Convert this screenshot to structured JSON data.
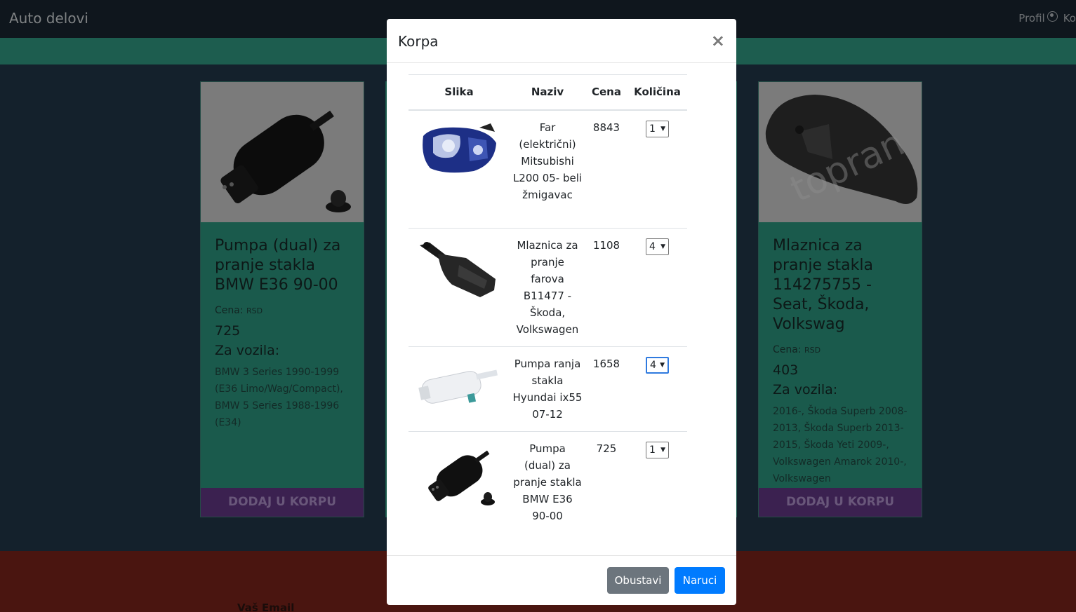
{
  "navbar": {
    "brand": "Auto delovi",
    "profile_label": "Profil",
    "cart_label": "Ko"
  },
  "cards": [
    {
      "title": "Pumpa (dual) za pranje stakla BMW E36 90-00",
      "price_label": "Cena:",
      "currency": "RSD",
      "price": "725",
      "vehicles_title": "Za vozila:",
      "vehicles": "BMW 3 Series 1990-1999 (E36 Limo/Wag/Compact), BMW 5 Series 1988-1996 (E34)",
      "add_label": "DODAJ U KORPU"
    },
    {
      "title": "Mlaznica za pranje stakla 114275755 - Seat, Škoda, Volkswag",
      "price_label": "Cena:",
      "currency": "RSD",
      "price": "403",
      "vehicles_title": "Za vozila:",
      "vehicles": "2016-, Škoda Superb 2008-2013, Škoda Superb 2013-2015, Škoda Yeti 2009-, Volkswagen Amarok 2010-, Volkswagen",
      "add_label": "DODAJ U KORPU"
    }
  ],
  "footer": {
    "email_label": "Vaš Email"
  },
  "modal": {
    "title": "Korpa",
    "close": "×",
    "headers": {
      "image": "Slika",
      "name": "Naziv",
      "price": "Cena",
      "qty": "Količina"
    },
    "items": [
      {
        "name": "Far (električni) Mitsubishi L200 05- beli žmigavac",
        "price": "8843",
        "qty": "1",
        "icon": "headlight-image"
      },
      {
        "name": "Mlaznica za pranje farova B11477 - Škoda, Volkswagen",
        "price": "1108",
        "qty": "4",
        "icon": "nozzle-image"
      },
      {
        "name": "Pumpa ranja stakla Hyundai ix55 07-12",
        "price": "1658",
        "qty": "4",
        "icon": "white-pump-image"
      },
      {
        "name": "Pumpa (dual) za pranje stakla BMW E36 90-00",
        "price": "725",
        "qty": "1",
        "icon": "black-pump-image"
      }
    ],
    "cancel_label": "Obustavi",
    "order_label": "Naruci"
  }
}
